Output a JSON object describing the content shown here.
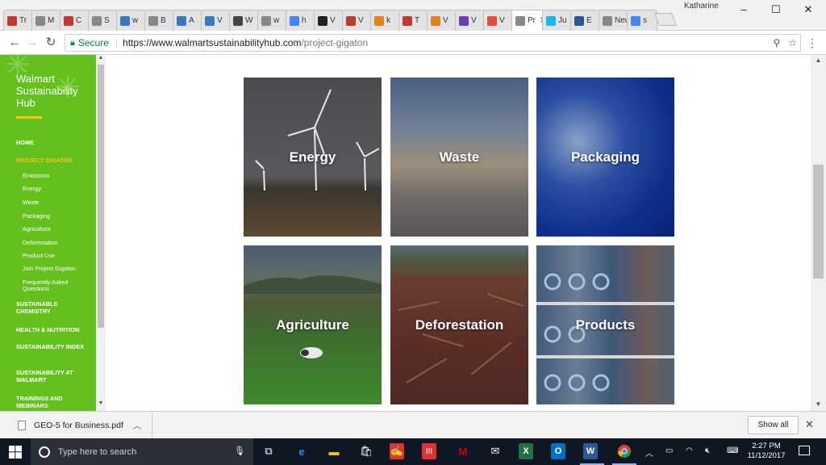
{
  "browser": {
    "tabs": [
      {
        "label": "Tr",
        "icon": "generic-page-icon",
        "color": "#c0392b"
      },
      {
        "label": "M",
        "icon": "generic-page-icon",
        "color": "#888888"
      },
      {
        "label": "C",
        "icon": "generic-page-icon",
        "color": "#c0392b"
      },
      {
        "label": "S",
        "icon": "generic-page-icon",
        "color": "#888888"
      },
      {
        "label": "w",
        "icon": "wiki-icon",
        "color": "#3b78c4"
      },
      {
        "label": "B",
        "icon": "generic-page-icon",
        "color": "#888888"
      },
      {
        "label": "A",
        "icon": "proquest-icon",
        "color": "#3b78c4"
      },
      {
        "label": "V",
        "icon": "proquest-icon",
        "color": "#3b78c4"
      },
      {
        "label": "W",
        "icon": "gs-icon",
        "color": "#444444"
      },
      {
        "label": "w",
        "icon": "generic-page-icon",
        "color": "#888888"
      },
      {
        "label": "h",
        "icon": "google-icon",
        "color": "#4285f4"
      },
      {
        "label": "V",
        "icon": "wsj-icon",
        "color": "#222222"
      },
      {
        "label": "V",
        "icon": "hbr-icon",
        "color": "#c0392b"
      },
      {
        "label": "k",
        "icon": "orange-icon",
        "color": "#e67e22"
      },
      {
        "label": "T",
        "icon": "ssir-icon",
        "color": "#c0392b"
      },
      {
        "label": "V",
        "icon": "generic-page-icon",
        "color": "#e67e22"
      },
      {
        "label": "V",
        "icon": "b-icon",
        "color": "#6a3fb5"
      },
      {
        "label": "V",
        "icon": "e-icon",
        "color": "#e74c3c"
      },
      {
        "label": "Pr",
        "icon": "generic-page-icon",
        "color": "#888888",
        "active": true
      },
      {
        "label": "Ju",
        "icon": "vimeo-icon",
        "color": "#1ab7ea"
      },
      {
        "label": "E",
        "icon": "word-icon",
        "color": "#2b5797"
      },
      {
        "label": "New",
        "icon": "generic-page-icon",
        "color": "#888888"
      },
      {
        "label": "s",
        "icon": "google-icon",
        "color": "#4285f4"
      }
    ],
    "profile_name": "Katharine",
    "secure_label": "Secure",
    "url_host": "https://www.walmartsustainabilityhub.com",
    "url_path": "/project-gigaton"
  },
  "sidebar": {
    "logo_lines": [
      "Walmart",
      "Sustainability",
      "Hub"
    ],
    "items": [
      {
        "label": "HOME",
        "type": "main"
      },
      {
        "label": "PROJECT GIGATON",
        "type": "main",
        "active": true
      },
      {
        "label": "Emissions",
        "type": "sub"
      },
      {
        "label": "Energy",
        "type": "sub"
      },
      {
        "label": "Waste",
        "type": "sub"
      },
      {
        "label": "Packaging",
        "type": "sub"
      },
      {
        "label": "Agriculture",
        "type": "sub"
      },
      {
        "label": "Deforestation",
        "type": "sub"
      },
      {
        "label": "Product Use",
        "type": "sub"
      },
      {
        "label": "Join Project Gigaton",
        "type": "sub"
      },
      {
        "label": "Frequently Asked Questions",
        "type": "sub"
      },
      {
        "label": "SUSTAINABLE CHEMISTRY",
        "type": "main"
      },
      {
        "label": "HEALTH & NUTRITION",
        "type": "main"
      },
      {
        "label": "SUSTAINABILITY INDEX",
        "type": "main"
      },
      {
        "label": "SUSTAINABILITY AT WALMART",
        "type": "main"
      },
      {
        "label": "TRAININGS AND WEBINARS",
        "type": "main"
      }
    ]
  },
  "tiles": [
    {
      "label": "Energy",
      "key": "energy"
    },
    {
      "label": "Waste",
      "key": "waste"
    },
    {
      "label": "Packaging",
      "key": "packaging"
    },
    {
      "label": "Agriculture",
      "key": "agriculture"
    },
    {
      "label": "Deforestation",
      "key": "deforestation"
    },
    {
      "label": "Products",
      "key": "products"
    }
  ],
  "download_bar": {
    "file_name": "GEO-5 for Business.pdf",
    "show_all_label": "Show all"
  },
  "taskbar": {
    "search_placeholder": "Type here to search",
    "time": "2:27 PM",
    "date": "11/12/2017"
  }
}
